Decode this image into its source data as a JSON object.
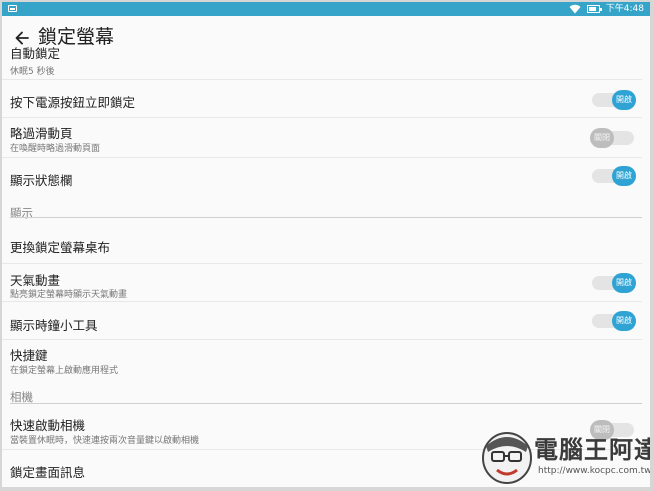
{
  "status_bar": {
    "time": "下午4:48"
  },
  "app_bar": {
    "title": "鎖定螢幕"
  },
  "rows": {
    "auto_lock": {
      "title": "自動鎖定",
      "subtitle": "休眠5 秒後"
    },
    "power_lock": {
      "title": "按下電源按鈕立即鎖定",
      "toggle": "開啟"
    },
    "skip_slide": {
      "title": "略過滑動頁",
      "subtitle": "在喚醒時略過滑動頁面",
      "toggle": "關閉"
    },
    "status_bar_row": {
      "title": "顯示狀態欄",
      "toggle": "開啟"
    },
    "change_wallpaper": {
      "title": "更換鎖定螢幕桌布"
    },
    "weather": {
      "title": "天氣動畫",
      "subtitle": "點亮鎖定螢幕時顯示天氣動畫",
      "toggle": "開啟"
    },
    "clock_widget": {
      "title": "顯示時鐘小工具",
      "toggle": "開啟"
    },
    "shortcuts": {
      "title": "快捷鍵",
      "subtitle": "在鎖定螢幕上啟動應用程式"
    },
    "quick_camera": {
      "title": "快速啟動相機",
      "subtitle": "當裝置休眠時，快速連按兩次音量鍵以啟動相機",
      "toggle": "關閉"
    },
    "lock_message": {
      "title": "鎖定畫面訊息"
    }
  },
  "sections": {
    "display": "顯示",
    "camera": "相機"
  },
  "watermark": {
    "name": "電腦王阿達",
    "url": "http://www.kocpc.com.tw"
  },
  "colors": {
    "status_bar": "#35a4c8",
    "toggle_on": "#2fa4d4",
    "toggle_off": "#bdbdbd"
  }
}
